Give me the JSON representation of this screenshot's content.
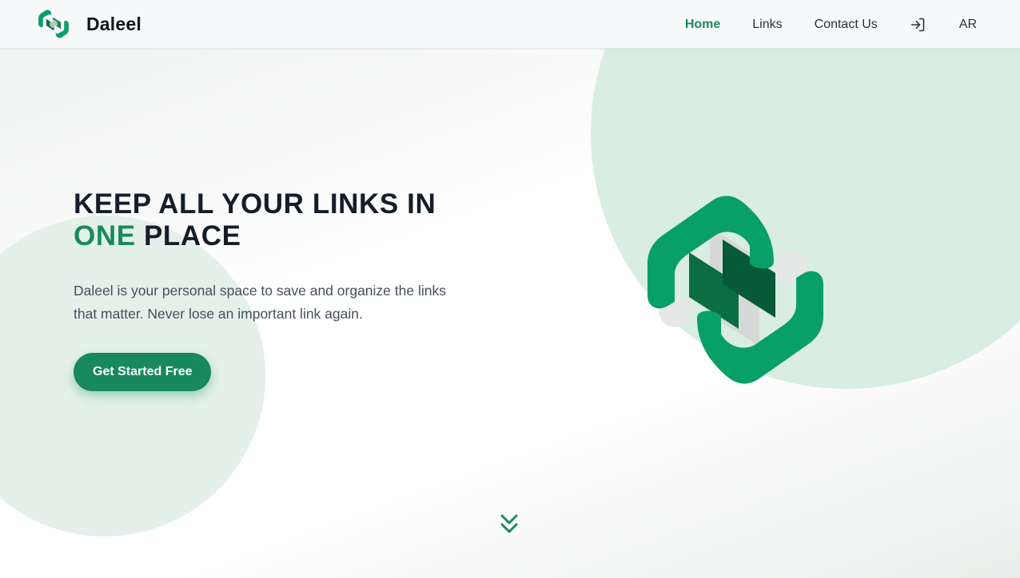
{
  "brand": {
    "name": "Daleel",
    "logo_icon": "daleel-logo-icon",
    "accent_color": "#1a8a5c"
  },
  "nav": {
    "items": [
      {
        "label": "Home",
        "active": true
      },
      {
        "label": "Links",
        "active": false
      },
      {
        "label": "Contact Us",
        "active": false
      }
    ],
    "login_icon": "login-icon",
    "language": "AR"
  },
  "hero": {
    "title_line1": "KEEP ALL YOUR LINKS IN",
    "title_accent": "ONE",
    "title_rest": " PLACE",
    "subtitle": "Daleel is your personal space to save and organize the links that matter. Never lose an important link again.",
    "cta_label": "Get Started Free"
  },
  "scroll_icon": "double-chevron-down-icon"
}
